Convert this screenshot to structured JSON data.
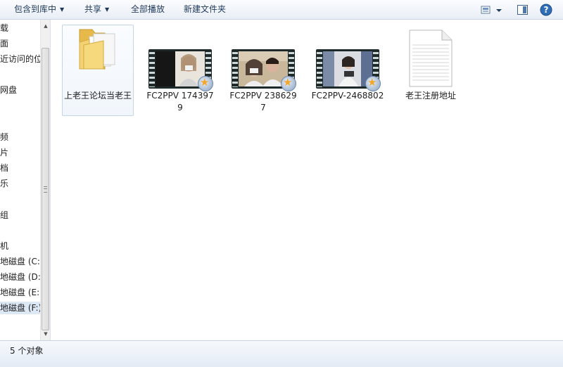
{
  "toolbar": {
    "include_library": "包含到库中",
    "share": "共享",
    "play_all": "全部播放",
    "new_folder": "新建文件夹",
    "help": "?"
  },
  "nav": {
    "items": [
      {
        "label": "载"
      },
      {
        "label": "面"
      },
      {
        "label": "近访问的位"
      },
      {
        "label": "网盘"
      },
      {
        "label": "频"
      },
      {
        "label": "片"
      },
      {
        "label": "档"
      },
      {
        "label": "乐"
      },
      {
        "label": "组"
      },
      {
        "label": "机"
      },
      {
        "label": "地磁盘 (C:)"
      },
      {
        "label": "地磁盘 (D:)"
      },
      {
        "label": "地磁盘 (E:)"
      },
      {
        "label": "地磁盘 (F:)"
      }
    ]
  },
  "files": [
    {
      "name": "上老王论坛当老王",
      "type": "folder"
    },
    {
      "name": "FC2PPV 1743979",
      "type": "video"
    },
    {
      "name": "FC2PPV 2386297",
      "type": "video"
    },
    {
      "name": "FC2PPV-2468802",
      "type": "video"
    },
    {
      "name": "老王注册地址",
      "type": "document"
    }
  ],
  "status": {
    "count_text": "5 个对象"
  },
  "colors": {
    "toolbar_text": "#1e395b",
    "selection": "#dde8f5",
    "folder": "#f1cf6b"
  }
}
